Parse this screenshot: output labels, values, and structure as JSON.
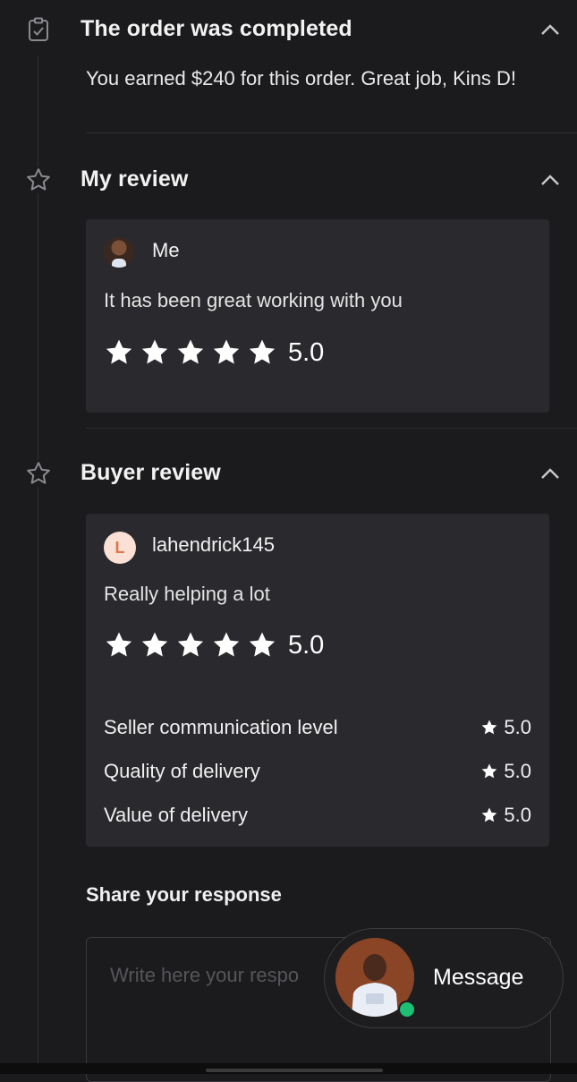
{
  "order": {
    "title": "The order was completed",
    "message": "You earned $240 for this order. Great job, Kins D!"
  },
  "my_review": {
    "title": "My review",
    "reviewer": "Me",
    "text": "It has been great working with you",
    "rating": "5.0",
    "stars": 5
  },
  "buyer_review": {
    "title": "Buyer review",
    "avatar_letter": "L",
    "reviewer": "lahendrick145",
    "text": "Really helping a lot",
    "rating": "5.0",
    "stars": 5,
    "metrics": [
      {
        "label": "Seller communication level",
        "score": "5.0"
      },
      {
        "label": "Quality of delivery",
        "score": "5.0"
      },
      {
        "label": "Value of delivery",
        "score": "5.0"
      }
    ]
  },
  "response": {
    "title": "Share your response",
    "placeholder": "Write here your respo"
  },
  "message_button": {
    "label": "Message",
    "status": "online"
  },
  "colors": {
    "background": "#1b1b1d",
    "card": "#2a2a2e",
    "online": "#1dbf73",
    "avatar_letter_bg": "#fbe0d5",
    "avatar_letter_fg": "#e0754a"
  },
  "icons": {
    "order": "clipboard-check-icon",
    "review": "star-outline-icon",
    "collapse": "chevron-up-icon",
    "rating": "star-filled-icon"
  }
}
